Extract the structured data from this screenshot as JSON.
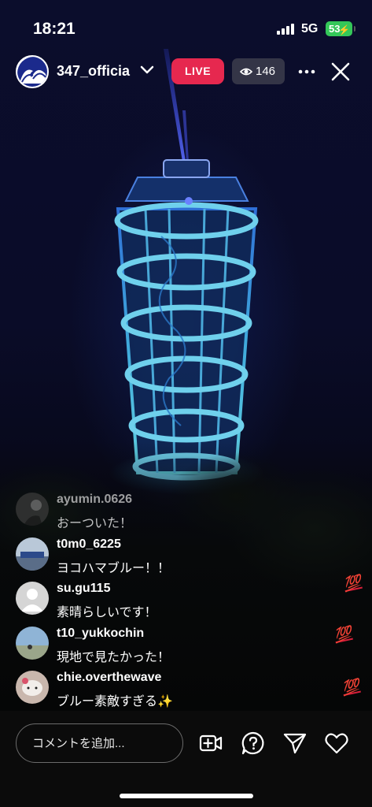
{
  "status_bar": {
    "time": "18:21",
    "network": "5G",
    "battery": "53"
  },
  "header": {
    "username": "347_officia",
    "live_label": "LIVE",
    "viewer_count": "146"
  },
  "comments": [
    {
      "user": "ayumin.0626",
      "text": "おーついた！"
    },
    {
      "user": "t0m0_6225",
      "text": "ヨコハマブルー！！"
    },
    {
      "user": "su.gu115",
      "text": "素晴らしいです！"
    },
    {
      "user": "t10_yukkochin",
      "text": "現地で見たかった！"
    },
    {
      "user": "chie.overthewave",
      "text": "ブルー素敵すぎる✨"
    }
  ],
  "reactions": [
    "💯",
    "💯",
    "💯"
  ],
  "bottom_bar": {
    "comment_placeholder": "コメントを追加..."
  },
  "icons": [
    "add-video-icon",
    "question-icon",
    "send-icon",
    "heart-icon",
    "more-icon",
    "close-icon",
    "eye-icon",
    "chevron-down-icon"
  ],
  "colors": {
    "live_badge": "#e6284f",
    "battery": "#34c759"
  }
}
